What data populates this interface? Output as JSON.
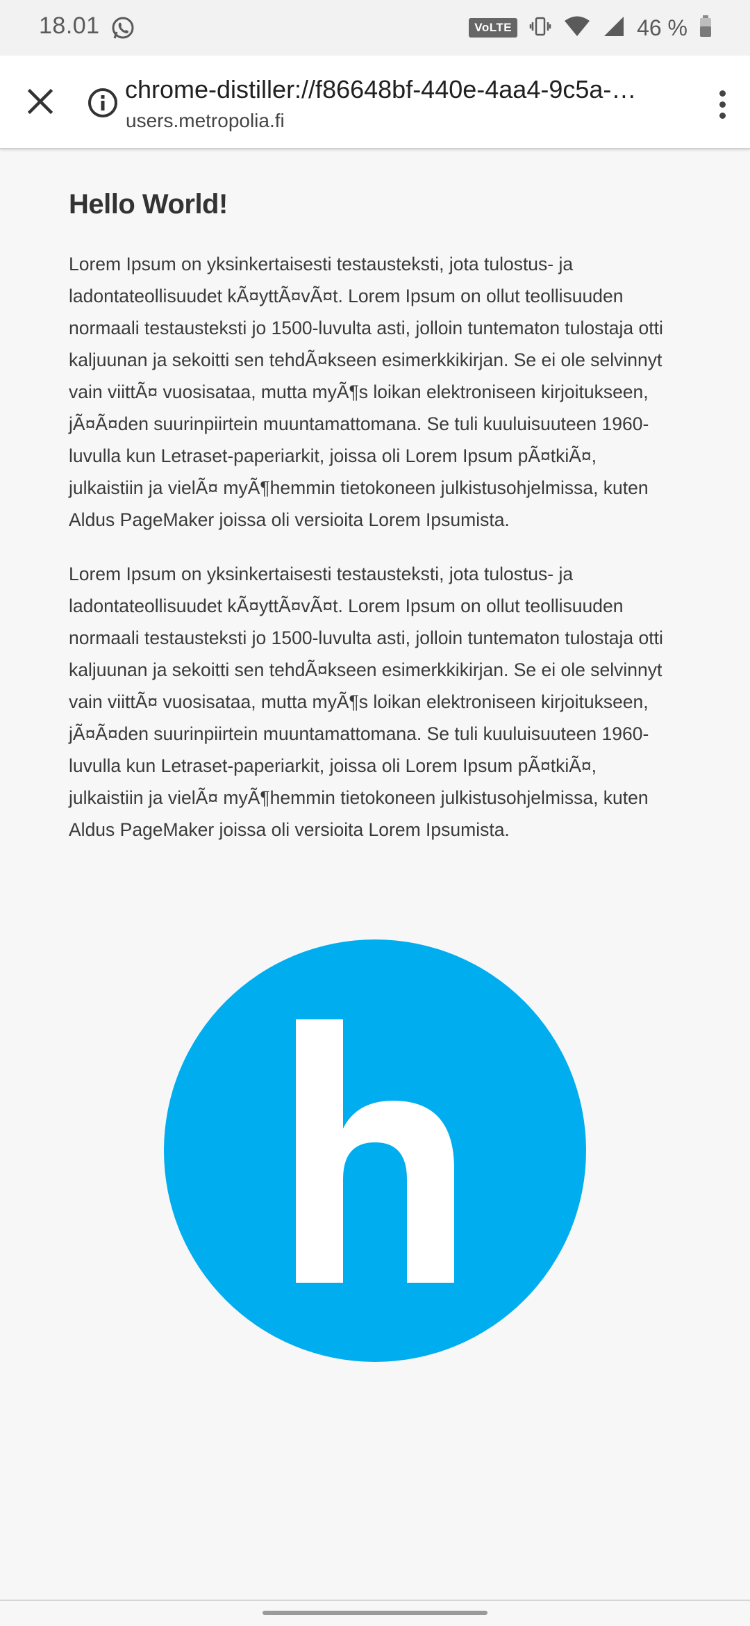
{
  "status_bar": {
    "time": "18.01",
    "network_badge": "VoLTE",
    "battery": "46 %",
    "icons": [
      "whatsapp-icon",
      "vibrate-icon",
      "wifi-icon",
      "signal-icon",
      "battery-icon"
    ]
  },
  "toolbar": {
    "url": "chrome-distiller://f86648bf-440e-4aa4-9c5a-…",
    "domain": "users.metropolia.fi",
    "icons": [
      "close-icon",
      "info-icon",
      "more-vert-icon"
    ]
  },
  "article": {
    "title": "Hello World!",
    "paragraphs": [
      "Lorem Ipsum on yksinkertaisesti testausteksti, jota tulostus- ja ladontateollisuudet kÃ¤yttÃ¤vÃ¤t. Lorem Ipsum on ollut teollisuuden normaali testausteksti jo 1500-luvulta asti, jolloin tuntematon tulostaja otti kaljuunan ja sekoitti sen tehdÃ¤kseen esimerkkikirjan. Se ei ole selvinnyt vain viittÃ¤ vuosisataa, mutta myÃ¶s loikan elektroniseen kirjoitukseen, jÃ¤Ã¤den suurinpiirtein muuntamattomana. Se tuli kuuluisuuteen 1960-luvulla kun Letraset-paperiarkit, joissa oli Lorem Ipsum pÃ¤tkiÃ¤, julkaistiin ja vielÃ¤ myÃ¶hemmin tietokoneen julkistusohjelmissa, kuten Aldus PageMaker joissa oli versioita Lorem Ipsumista.",
      "Lorem Ipsum on yksinkertaisesti testausteksti, jota tulostus- ja ladontateollisuudet kÃ¤yttÃ¤vÃ¤t. Lorem Ipsum on ollut teollisuuden normaali testausteksti jo 1500-luvulta asti, jolloin tuntematon tulostaja otti kaljuunan ja sekoitti sen tehdÃ¤kseen esimerkkikirjan. Se ei ole selvinnyt vain viittÃ¤ vuosisataa, mutta myÃ¶s loikan elektroniseen kirjoitukseen, jÃ¤Ã¤den suurinpiirtein muuntamattomana. Se tuli kuuluisuuteen 1960-luvulla kun Letraset-paperiarkit, joissa oli Lorem Ipsum pÃ¤tkiÃ¤, julkaistiin ja vielÃ¤ myÃ¶hemmin tietokoneen julkistusohjelmissa, kuten Aldus PageMaker joissa oli versioita Lorem Ipsumista."
    ],
    "logo": {
      "letter": "h",
      "color": "#00adef",
      "letter_color": "#ffffff"
    }
  },
  "colors": {
    "background": "#f7f7f7",
    "toolbar": "#ffffff",
    "text": "#3a3a3a"
  }
}
